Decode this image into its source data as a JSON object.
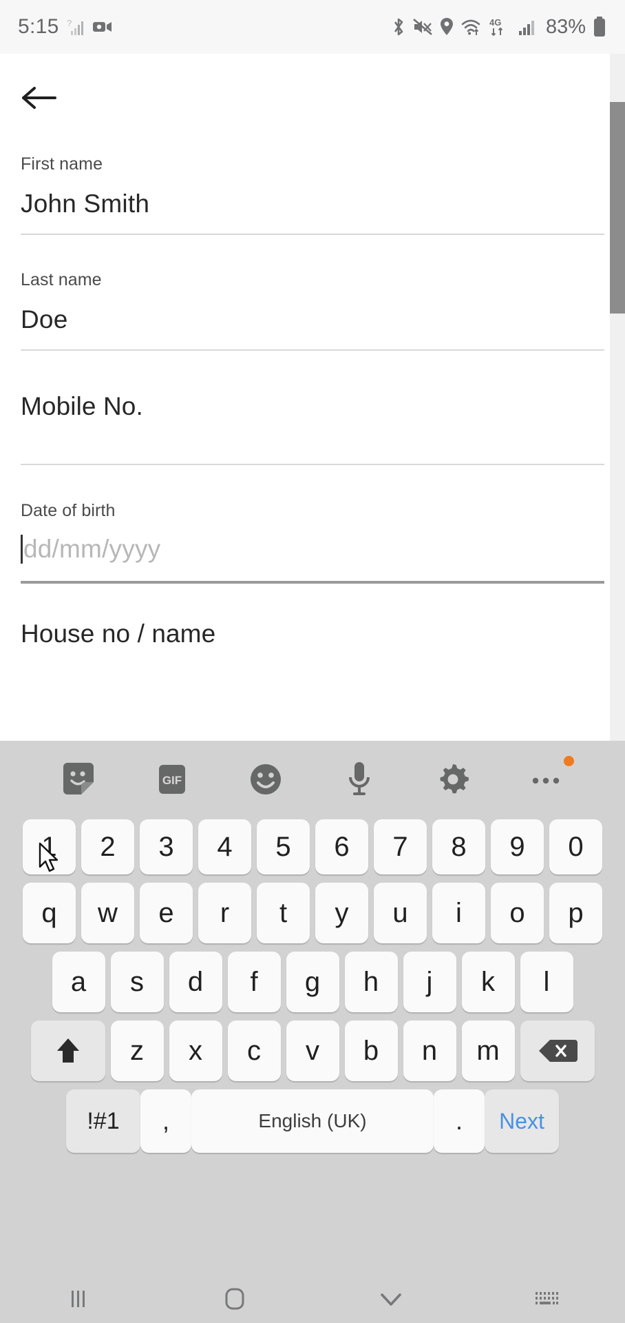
{
  "status_bar": {
    "time": "5:15",
    "battery_percent": "83%",
    "left_icons": [
      "signal-unknown-icon",
      "video-camera-icon"
    ],
    "right_icons": [
      "bluetooth-icon",
      "mute-icon",
      "location-icon",
      "wifi-icon",
      "4g-icon",
      "cellular-signal-icon",
      "battery-icon"
    ],
    "network_label": "4G"
  },
  "form": {
    "back_label": "back-arrow",
    "fields": [
      {
        "label": "First name",
        "value": "John Smith",
        "placeholder": "",
        "focused": false
      },
      {
        "label": "Last name",
        "value": "Doe",
        "placeholder": "",
        "focused": false
      },
      {
        "label": "Mobile No.",
        "value": "",
        "placeholder": "",
        "focused": false
      },
      {
        "label": "Date of birth",
        "value": "",
        "placeholder": "dd/mm/yyyy",
        "focused": true
      },
      {
        "label": "House no / name",
        "value": "",
        "placeholder": "",
        "focused": false
      }
    ]
  },
  "keyboard": {
    "toolbar": [
      {
        "name": "sticker-icon",
        "label": ""
      },
      {
        "name": "gif-icon",
        "label": "GIF"
      },
      {
        "name": "emoji-icon",
        "label": ""
      },
      {
        "name": "microphone-icon",
        "label": ""
      },
      {
        "name": "gear-icon",
        "label": ""
      },
      {
        "name": "more-options-icon",
        "label": ""
      }
    ],
    "number_row": [
      "1",
      "2",
      "3",
      "4",
      "5",
      "6",
      "7",
      "8",
      "9",
      "0"
    ],
    "row_q": [
      "q",
      "w",
      "e",
      "r",
      "t",
      "y",
      "u",
      "i",
      "o",
      "p"
    ],
    "row_a": [
      "a",
      "s",
      "d",
      "f",
      "g",
      "h",
      "j",
      "k",
      "l"
    ],
    "row_z": [
      "z",
      "x",
      "c",
      "v",
      "b",
      "n",
      "m"
    ],
    "shift_label": "shift-icon",
    "backspace_label": "backspace-icon",
    "bottom_row": {
      "symbols": "!#1",
      "comma": ",",
      "space": "English (UK)",
      "period": ".",
      "action": "Next"
    }
  },
  "nav_bar": {
    "recents": "recents-icon",
    "home": "home-icon",
    "back": "dismiss-keyboard-icon",
    "keyboard_toggle": "keyboard-icon"
  },
  "colors": {
    "accent": "#4a90e2",
    "keyboard_bg": "#d2d2d2",
    "key_bg": "#fafafa",
    "badge": "#f07b1e"
  }
}
